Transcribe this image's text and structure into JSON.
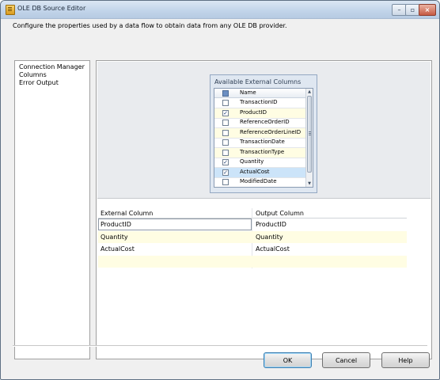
{
  "window": {
    "title": "OLE DB Source Editor",
    "minimize_glyph": "–",
    "maximize_glyph": "▫",
    "close_glyph": "×"
  },
  "description": "Configure the properties used by a data flow to obtain data from any OLE DB provider.",
  "nav": {
    "items": [
      {
        "label": "Connection Manager"
      },
      {
        "label": "Columns"
      },
      {
        "label": "Error Output"
      }
    ]
  },
  "available_columns": {
    "title": "Available External Columns",
    "header": "Name",
    "items": [
      {
        "label": "TransactionID",
        "checked": false
      },
      {
        "label": "ProductID",
        "checked": true
      },
      {
        "label": "ReferenceOrderID",
        "checked": false
      },
      {
        "label": "ReferenceOrderLineID",
        "checked": false
      },
      {
        "label": "TransactionDate",
        "checked": false
      },
      {
        "label": "TransactionType",
        "checked": false
      },
      {
        "label": "Quantity",
        "checked": true
      },
      {
        "label": "ActualCost",
        "checked": true
      },
      {
        "label": "ModifiedDate",
        "checked": false
      }
    ],
    "check_glyph": "✓",
    "scroll_up": "▲",
    "scroll_down": "▼"
  },
  "mapping": {
    "headers": {
      "external": "External Column",
      "output": "Output Column"
    },
    "rows": [
      {
        "external": "ProductID",
        "output": "ProductID"
      },
      {
        "external": "Quantity",
        "output": "Quantity"
      },
      {
        "external": "ActualCost",
        "output": "ActualCost"
      },
      {
        "external": "",
        "output": ""
      }
    ]
  },
  "buttons": {
    "ok": "OK",
    "cancel": "Cancel",
    "help": "Help"
  },
  "colors": {
    "row_alt": "#fffde3",
    "selected_row": "#cce4f9",
    "default_button_border": "#3c7fb1"
  }
}
